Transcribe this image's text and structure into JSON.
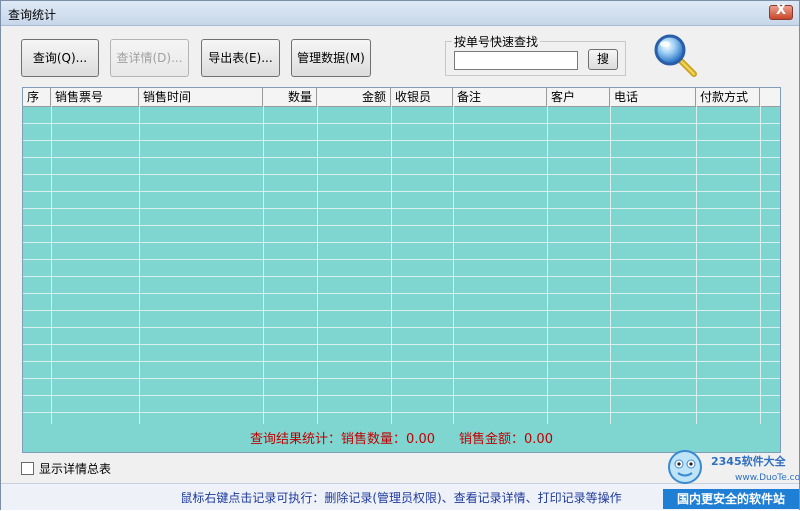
{
  "window": {
    "title": "查询统计",
    "close_label": "X"
  },
  "toolbar": {
    "query_label": "查询(Q)...",
    "detail_label": "查详情(D)...",
    "export_label": "导出表(E)...",
    "manage_label": "管理数据(M)"
  },
  "search": {
    "group_label": "按单号快速查找",
    "value": "",
    "button_label": "搜"
  },
  "grid": {
    "columns": [
      "序",
      "销售票号",
      "销售时间",
      "数量",
      "金额",
      "收银员",
      "备注",
      "客户",
      "电话",
      "付款方式"
    ],
    "row_color": "#7fd5cf",
    "rows": []
  },
  "summary": {
    "label": "查询结果统计：",
    "qty_label": "销售数量：",
    "qty_value": "0.00",
    "amount_label": "销售金额：",
    "amount_value": "0.00"
  },
  "show_detail": {
    "label": "显示详情总表",
    "checked": false
  },
  "status": {
    "hint": "鼠标右键点击记录可执行：删除记录(管理员权限)、查看记录详情、打印记录等操作"
  },
  "watermark": {
    "brand": "2345软件大全",
    "url": "www.DuoTe.com",
    "slogan": "国内更安全的软件站"
  }
}
